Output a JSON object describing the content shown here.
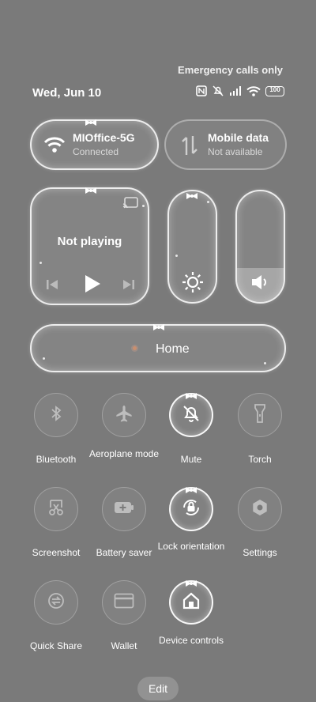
{
  "status_bar": {
    "emergency": "Emergency calls only",
    "date": "Wed, Jun 10",
    "battery": "100",
    "icons": [
      "nfc-icon",
      "mute-icon",
      "signal-icon",
      "wifi-icon",
      "battery-icon"
    ]
  },
  "wifi_tile": {
    "title": "MIOffice-5G",
    "subtitle": "Connected",
    "icon": "wifi-icon"
  },
  "mobile_tile": {
    "title": "Mobile data",
    "subtitle": "Not available",
    "icon": "data-transfer-icon"
  },
  "media": {
    "status": "Not playing",
    "icons": [
      "cast-icon",
      "previous-icon",
      "play-icon",
      "next-icon"
    ]
  },
  "sliders": {
    "brightness": {
      "icon": "brightness-icon",
      "level": 0.0
    },
    "volume": {
      "icon": "volume-icon",
      "level": 0.3
    }
  },
  "home_tile": {
    "label": "Home",
    "icon": "home-dot-icon"
  },
  "toggles": [
    {
      "label": "Bluetooth",
      "icon": "bluetooth-icon",
      "on": false
    },
    {
      "label": "Aeroplane mode",
      "icon": "airplane-icon",
      "on": false
    },
    {
      "label": "Mute",
      "icon": "mute-bell-icon",
      "on": true
    },
    {
      "label": "Torch",
      "icon": "torch-icon",
      "on": false
    },
    {
      "label": "Screenshot",
      "icon": "screenshot-icon",
      "on": false
    },
    {
      "label": "Battery saver",
      "icon": "battery-saver-icon",
      "on": false
    },
    {
      "label": "Lock orientation",
      "icon": "lock-rotation-icon",
      "on": true
    },
    {
      "label": "Settings",
      "icon": "settings-icon",
      "on": false
    },
    {
      "label": "Quick Share",
      "icon": "quick-share-icon",
      "on": false
    },
    {
      "label": "Wallet",
      "icon": "wallet-icon",
      "on": false
    },
    {
      "label": "Device controls",
      "icon": "device-controls-icon",
      "on": true
    }
  ],
  "edit_label": "Edit"
}
